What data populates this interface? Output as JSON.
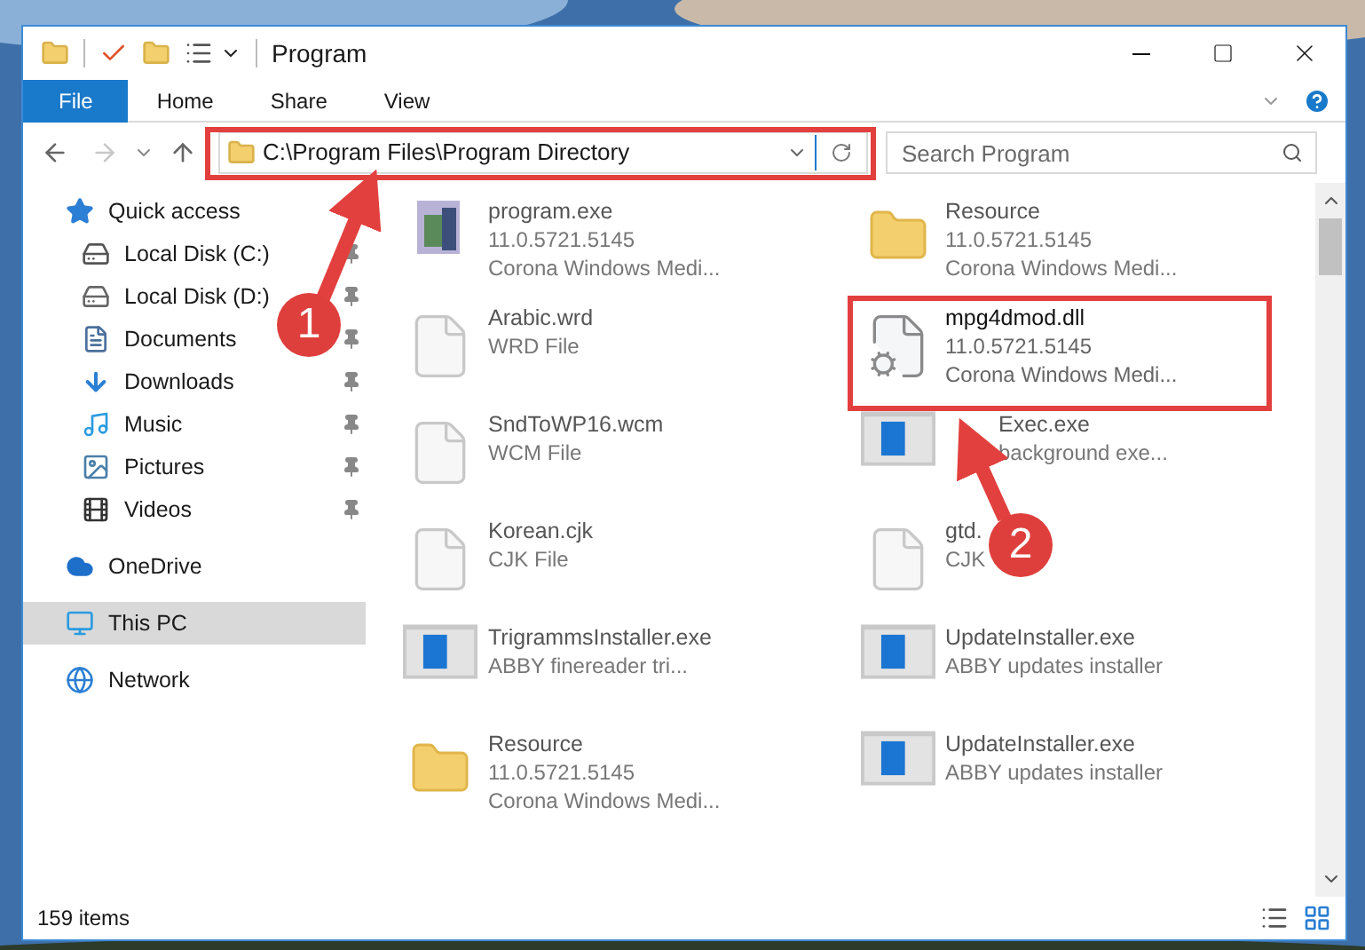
{
  "window": {
    "title": "Program"
  },
  "ribbon_tabs": [
    {
      "label": "File",
      "selected": true
    },
    {
      "label": "Home",
      "selected": false
    },
    {
      "label": "Share",
      "selected": false
    },
    {
      "label": "View",
      "selected": false
    }
  ],
  "address": {
    "path": "C:\\Program Files\\Program Directory"
  },
  "search": {
    "placeholder": "Search Program"
  },
  "nav": [
    {
      "label": "Quick access",
      "kind": "star",
      "pinned": false,
      "selected": false,
      "children": [
        {
          "label": "Local Disk (C:)",
          "kind": "drive-c",
          "pinned": true,
          "selected": false
        },
        {
          "label": "Local Disk (D:)",
          "kind": "drive",
          "pinned": true,
          "selected": false
        },
        {
          "label": "Documents",
          "kind": "documents",
          "pinned": true,
          "selected": false
        },
        {
          "label": "Downloads",
          "kind": "downloads",
          "pinned": true,
          "selected": false
        },
        {
          "label": "Music",
          "kind": "music",
          "pinned": true,
          "selected": false
        },
        {
          "label": "Pictures",
          "kind": "pictures",
          "pinned": true,
          "selected": false
        },
        {
          "label": "Videos",
          "kind": "videos",
          "pinned": true,
          "selected": false
        }
      ]
    },
    {
      "label": "OneDrive",
      "kind": "cloud",
      "pinned": false,
      "selected": false
    },
    {
      "label": "This PC",
      "kind": "pc",
      "pinned": false,
      "selected": true
    },
    {
      "label": "Network",
      "kind": "network",
      "pinned": false,
      "selected": false
    }
  ],
  "files": [
    {
      "kind": "app",
      "blurred": true,
      "name": "program.exe",
      "details": [
        "11.0.5721.5145",
        "Corona Windows Medi..."
      ]
    },
    {
      "kind": "folder",
      "blurred": true,
      "name": "Resource",
      "details": [
        "11.0.5721.5145",
        "Corona Windows Medi..."
      ]
    },
    {
      "kind": "blank",
      "blurred": true,
      "name": "Arabic.wrd",
      "details": [
        "WRD File"
      ]
    },
    {
      "kind": "dll",
      "blurred": false,
      "name": "mpg4dmod.dll",
      "details": [
        "11.0.5721.5145",
        "Corona Windows Medi..."
      ]
    },
    {
      "kind": "blank",
      "blurred": true,
      "name": "SndToWP16.wcm",
      "details": [
        "WCM File"
      ]
    },
    {
      "kind": "installer",
      "blurred": true,
      "name": "Exec.exe",
      "details": [
        "background exe..."
      ]
    },
    {
      "kind": "blank",
      "blurred": true,
      "name": "Korean.cjk",
      "details": [
        "CJK File"
      ]
    },
    {
      "kind": "blank",
      "blurred": true,
      "name": "gtd.",
      "details": [
        "CJK"
      ]
    },
    {
      "kind": "installer",
      "blurred": true,
      "name": "TrigrammsInstaller.exe",
      "details": [
        "ABBY finereader tri..."
      ]
    },
    {
      "kind": "installer",
      "blurred": true,
      "name": "UpdateInstaller.exe",
      "details": [
        "ABBY updates installer"
      ]
    },
    {
      "kind": "folder",
      "blurred": true,
      "name": "Resource",
      "details": [
        "11.0.5721.5145",
        "Corona Windows Medi..."
      ]
    },
    {
      "kind": "installer",
      "blurred": true,
      "name": "UpdateInstaller.exe",
      "details": [
        "ABBY updates installer"
      ]
    }
  ],
  "status_bar": {
    "count": "159 items"
  },
  "annotations": [
    {
      "label": "1"
    },
    {
      "label": "2"
    }
  ]
}
